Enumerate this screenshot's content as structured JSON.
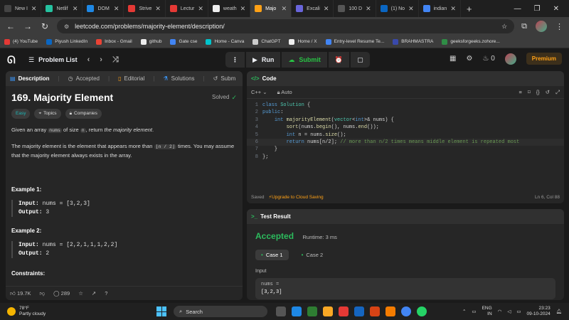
{
  "browser": {
    "tabs": [
      {
        "label": "New I",
        "color": "#444"
      },
      {
        "label": "Netlif",
        "color": "#25c2a0"
      },
      {
        "label": "DOM",
        "color": "#1e88e5"
      },
      {
        "label": "Strive",
        "color": "#e53935"
      },
      {
        "label": "Lectur",
        "color": "#e53935"
      },
      {
        "label": "weath",
        "color": "#eeeeee"
      },
      {
        "label": "Majo",
        "color": "#ffa116"
      },
      {
        "label": "Excali",
        "color": "#6965db"
      },
      {
        "label": "100 D",
        "color": "#555"
      },
      {
        "label": "(1) No",
        "color": "#0a66c2"
      },
      {
        "label": "indian",
        "color": "#4285f4"
      }
    ],
    "url": "leetcode.com/problems/majority-element/description/",
    "bookmarks": [
      {
        "label": "(4) YouTube",
        "color": "#e53935"
      },
      {
        "label": "Piyush LinkedIn",
        "color": "#0a66c2"
      },
      {
        "label": "Inbox - Gmail",
        "color": "#ea4335"
      },
      {
        "label": "github",
        "color": "#eeeeee"
      },
      {
        "label": "Gate cse",
        "color": "#4285f4"
      },
      {
        "label": "Home - Canva",
        "color": "#00c4cc"
      },
      {
        "label": "ChatGPT",
        "color": "#cccccc"
      },
      {
        "label": "Home / X",
        "color": "#eeeeee"
      },
      {
        "label": "Entry-level Resume Te...",
        "color": "#4285f4"
      },
      {
        "label": "BRAHMASTRA",
        "color": "#3949ab"
      },
      {
        "label": "geeksforgeeks.zohore...",
        "color": "#2f8d46"
      }
    ]
  },
  "header": {
    "problem_list": "Problem List",
    "run": "Run",
    "submit": "Submit",
    "streak": "0",
    "premium": "Premium"
  },
  "left": {
    "tabs": {
      "description": "Description",
      "accepted": "Accepted",
      "editorial": "Editorial",
      "solutions": "Solutions",
      "submissions": "Subm"
    },
    "title": "169. Majority Element",
    "solved": "Solved",
    "chips": {
      "easy": "Easy",
      "topics": "Topics",
      "companies": "Companies"
    },
    "p1": {
      "a": "Given an array ",
      "nums": "nums",
      "b": " of size ",
      "n": "n",
      "c": ", return ",
      "em": "the majority element",
      "d": "."
    },
    "p2": {
      "a": "The majority element is the element that appears more than ",
      "code": "⌊n / 2⌋",
      "b": " times. You may assume that the majority element always exists in the array."
    },
    "example1": {
      "title": "Example 1:",
      "input_label": "Input:",
      "input": "nums = [3,2,3]",
      "output_label": "Output:",
      "output": "3"
    },
    "example2": {
      "title": "Example 2:",
      "input_label": "Input:",
      "input": "nums = [2,2,1,1,1,2,2]",
      "output_label": "Output:",
      "output": "2"
    },
    "constraints": "Constraints:",
    "footer": {
      "likes": "19.7K",
      "comments": "289"
    }
  },
  "code": {
    "tab": "Code",
    "language": "C++",
    "auto": "Auto",
    "lines": [
      {
        "n": "1"
      },
      {
        "n": "2"
      },
      {
        "n": "3"
      },
      {
        "n": "4"
      },
      {
        "n": "5"
      },
      {
        "n": "6"
      },
      {
        "n": "7"
      },
      {
        "n": "8"
      }
    ],
    "status": {
      "saved": "Saved",
      "upgrade": "Upgrade to Cloud Saving",
      "position": "Ln 6, Col 88"
    }
  },
  "result": {
    "tab": "Test Result",
    "verdict": "Accepted",
    "runtime": "Runtime: 3 ms",
    "case1": "Case 1",
    "case2": "Case 2",
    "input_label": "Input",
    "var": "nums =",
    "value": "[3,2,3]"
  },
  "taskbar": {
    "temp": "78°F",
    "weather": "Partly cloudy",
    "search": "Search",
    "lang1": "ENG",
    "lang2": "IN",
    "time": "23:23",
    "date": "09-10-2024"
  }
}
